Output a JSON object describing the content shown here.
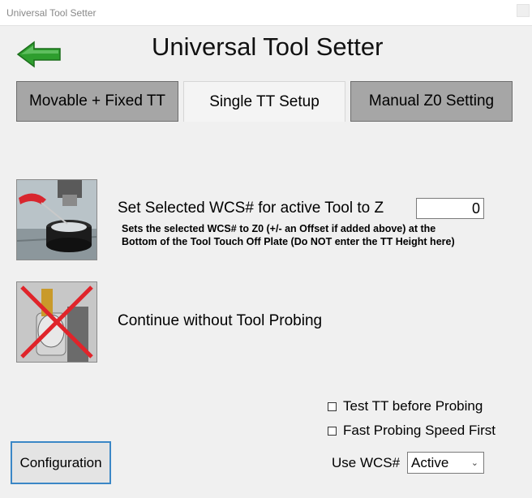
{
  "window": {
    "title": "Universal Tool Setter"
  },
  "header": {
    "title": "Universal Tool Setter"
  },
  "tabs": [
    {
      "label": "Movable + Fixed TT",
      "active": false
    },
    {
      "label": "Single TT Setup",
      "active": true
    },
    {
      "label": "Manual Z0 Setting",
      "active": false
    }
  ],
  "set_wcs": {
    "label": "Set Selected WCS# for active Tool to Z",
    "value": "0",
    "note_line1": "Sets the selected WCS# to Z0 (+/- an Offset if added above) at the",
    "note_line2": "Bottom of the Tool Touch Off Plate (Do NOT enter the TT Height here)"
  },
  "continue_without": {
    "label": "Continue without Tool Probing"
  },
  "options": {
    "test_tt": {
      "label": "Test TT before Probing",
      "checked": false
    },
    "fast_probe": {
      "label": "Fast Probing Speed First",
      "checked": false
    }
  },
  "config_button": {
    "label": "Configuration"
  },
  "use_wcs": {
    "label": "Use WCS#",
    "selected": "Active"
  },
  "colors": {
    "accent": "#3b87c6",
    "arrow": "#2e9e2e",
    "tab_inactive": "#a6a6a6"
  },
  "icons": {
    "back": "back-arrow-icon",
    "probe": "tool-probe-image",
    "no_probe": "no-probe-image"
  }
}
